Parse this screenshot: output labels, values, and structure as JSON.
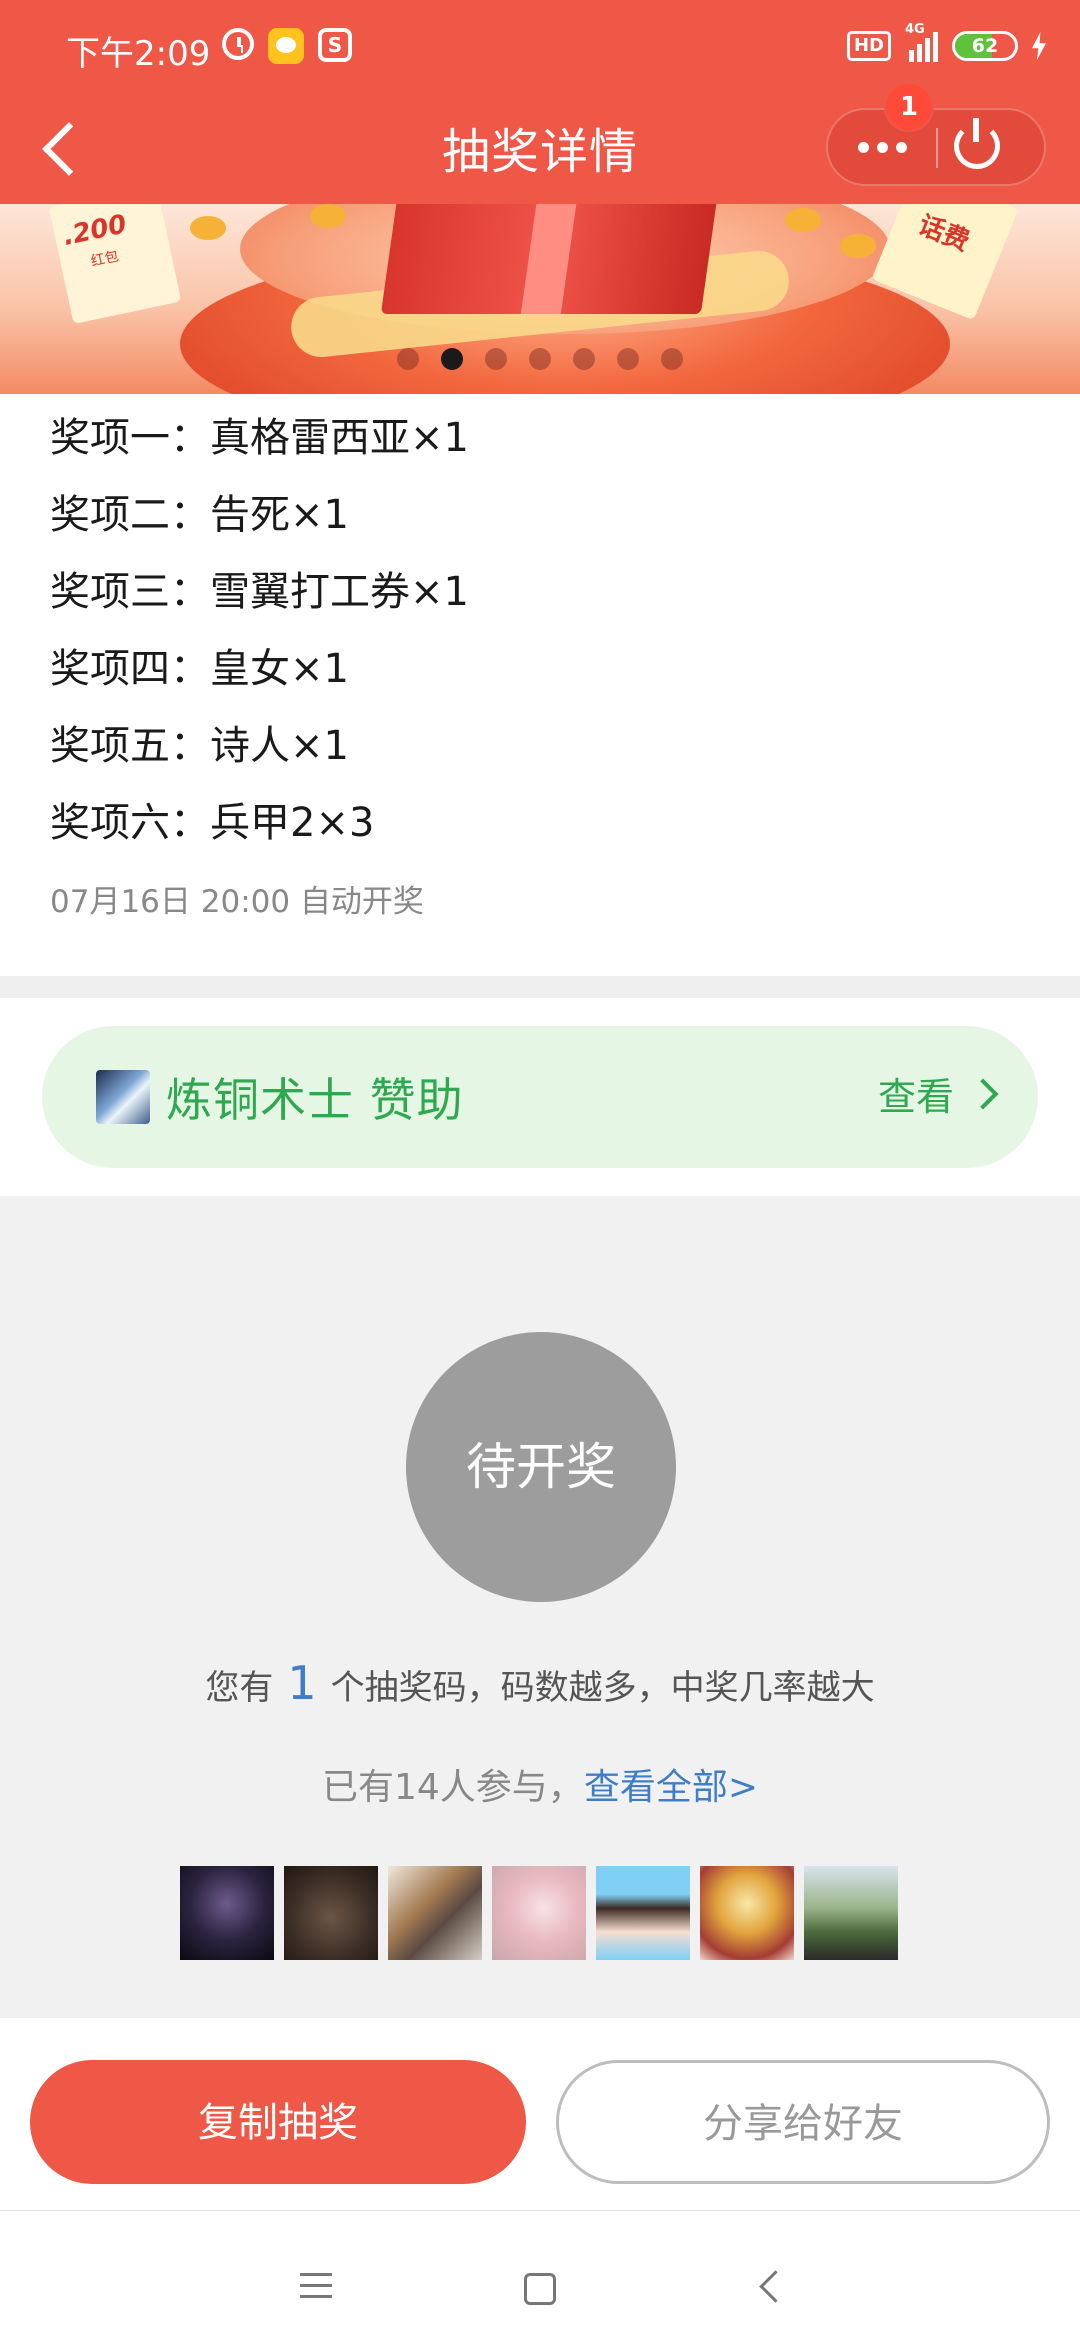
{
  "status_bar": {
    "time": "下午2:09",
    "hd": "HD",
    "network": "4G",
    "battery": "62",
    "battery_level": 0.62,
    "icons": [
      "alarm-icon",
      "app-notification-icon",
      "s-app-icon",
      "signal-icon",
      "battery-icon",
      "charging-icon"
    ]
  },
  "header": {
    "title": "抽奖详情",
    "badge_count": "1",
    "colors": {
      "primary": "#ef5747"
    }
  },
  "banner": {
    "tag_left_amount": ".200",
    "tag_left_sub": "红包",
    "tag_right_text": "话费",
    "slide_count": 7,
    "active_slide": 1
  },
  "prizes": [
    {
      "label": "奖项一：真格雷西亚×1"
    },
    {
      "label": "奖项二：告死×1"
    },
    {
      "label": "奖项三：雪翼打工券×1"
    },
    {
      "label": "奖项四：皇女×1"
    },
    {
      "label": "奖项五：诗人×1"
    },
    {
      "label": "奖项六：兵甲2×3"
    }
  ],
  "draw_time": "07月16日 20:00  自动开奖",
  "sponsor": {
    "name": "炼铜术士 赞助",
    "view_label": "查看",
    "color": "#2fa84f"
  },
  "status": {
    "pending_label": "待开奖",
    "codes_prefix": "您有",
    "codes_count": "1",
    "codes_suffix": "个抽奖码，码数越多，中奖几率越大",
    "participants_text": "已有14人参与，",
    "view_all_label": "查看全部>",
    "link_color": "#3f7ec7"
  },
  "participant_avatars": 7,
  "actions": {
    "copy_label": "复制抽奖",
    "share_label": "分享给好友"
  }
}
